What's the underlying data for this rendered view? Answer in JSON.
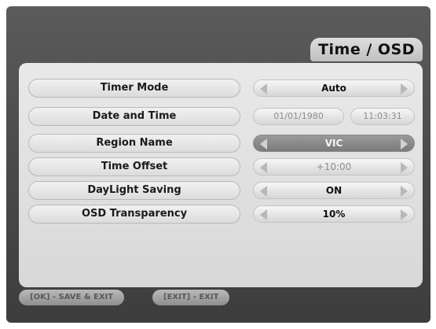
{
  "title": "Time / OSD",
  "rows": [
    {
      "label": "Timer Mode",
      "value": "Auto"
    },
    {
      "label": "Date and Time",
      "date": "01/01/1980",
      "time": "11:03:31"
    },
    {
      "label": "Region Name",
      "value": "VIC"
    },
    {
      "label": "Time Offset",
      "value": "+10:00"
    },
    {
      "label": "DayLight Saving",
      "value": "ON"
    },
    {
      "label": "OSD Transparency",
      "value": "10%"
    }
  ],
  "footer": {
    "ok": "[OK] - SAVE & EXIT",
    "exit": "[EXIT] - EXIT"
  }
}
